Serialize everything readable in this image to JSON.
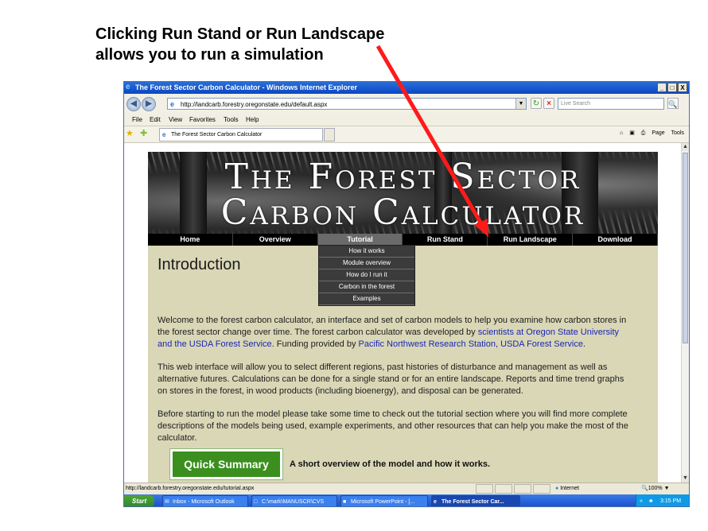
{
  "caption": {
    "line1": "Clicking Run Stand or Run Landscape",
    "line2": "allows you to run a simulation"
  },
  "window": {
    "title": "The Forest Sector Carbon Calculator - Windows Internet Explorer",
    "buttons": [
      "_",
      "□",
      "X"
    ]
  },
  "address_bar": {
    "url": "http://landcarb.forestry.oregonstate.edu/default.aspx",
    "search_placeholder": "Live Search"
  },
  "menu": [
    "File",
    "Edit",
    "View",
    "Favorites",
    "Tools",
    "Help"
  ],
  "tab": {
    "label": "The Forest Sector Carbon Calculator"
  },
  "command_bar": {
    "page_label": "Page",
    "tools_label": "Tools"
  },
  "site": {
    "banner_line1": "The Forest Sector",
    "banner_line2": "Carbon Calculator",
    "nav": [
      "Home",
      "Overview",
      "Tutorial",
      "Run Stand",
      "Run Landscape",
      "Download"
    ],
    "active_nav": "Tutorial",
    "tutorial_menu": [
      "How it works",
      "Module overview",
      "How do I run it",
      "Carbon in the forest",
      "Examples"
    ],
    "heading": "Introduction",
    "p1_a": "Welcome to the forest carbon calculator, an interface and set of carbon models to help you examine how carbon stores in the forest sector change over time. The forest carbon calculator was developed by ",
    "p1_link1": "scientists at Oregon State University and the USDA Forest Service",
    "p1_b": ". Funding provided by ",
    "p1_link2": "Pacific Northwest Research Station, USDA Forest Service",
    "p1_c": ".",
    "p2": "This web interface will allow you to select different regions, past histories of disturbance and management as well as alternative futures. Calculations can be done for a single stand or for an entire landscape. Reports and time trend graphs on stores in the forest, in wood products (including bioenergy), and disposal can be generated.",
    "p3": "Before starting to run the model please take some time to check out the tutorial section where you will find more complete descriptions of the models being used, example experiments, and other resources that can help you make the most of the calculator.",
    "quick_summary_label": "Quick Summary",
    "quick_summary_desc": "A short overview of the model and how it works."
  },
  "status_bar": {
    "url": "http://landcarb.forestry.oregonstate.edu/tutorial.aspx",
    "zone": "Internet",
    "zoom": "100%"
  },
  "taskbar": {
    "start": "Start",
    "items": [
      "Inbox - Microsoft Outlook",
      "C:\\mark\\MANUSCR\\CVS",
      "Microsoft PowerPoint - [...",
      "The Forest Sector Car..."
    ],
    "active_index": 3,
    "clock": "3:15 PM"
  },
  "colors": {
    "arrow": "#ff1a1a",
    "page_bg": "#d9d7b6",
    "nav_bg": "#000000",
    "quick_summary_bg": "#3a8f1e",
    "link": "#1a26b8"
  }
}
